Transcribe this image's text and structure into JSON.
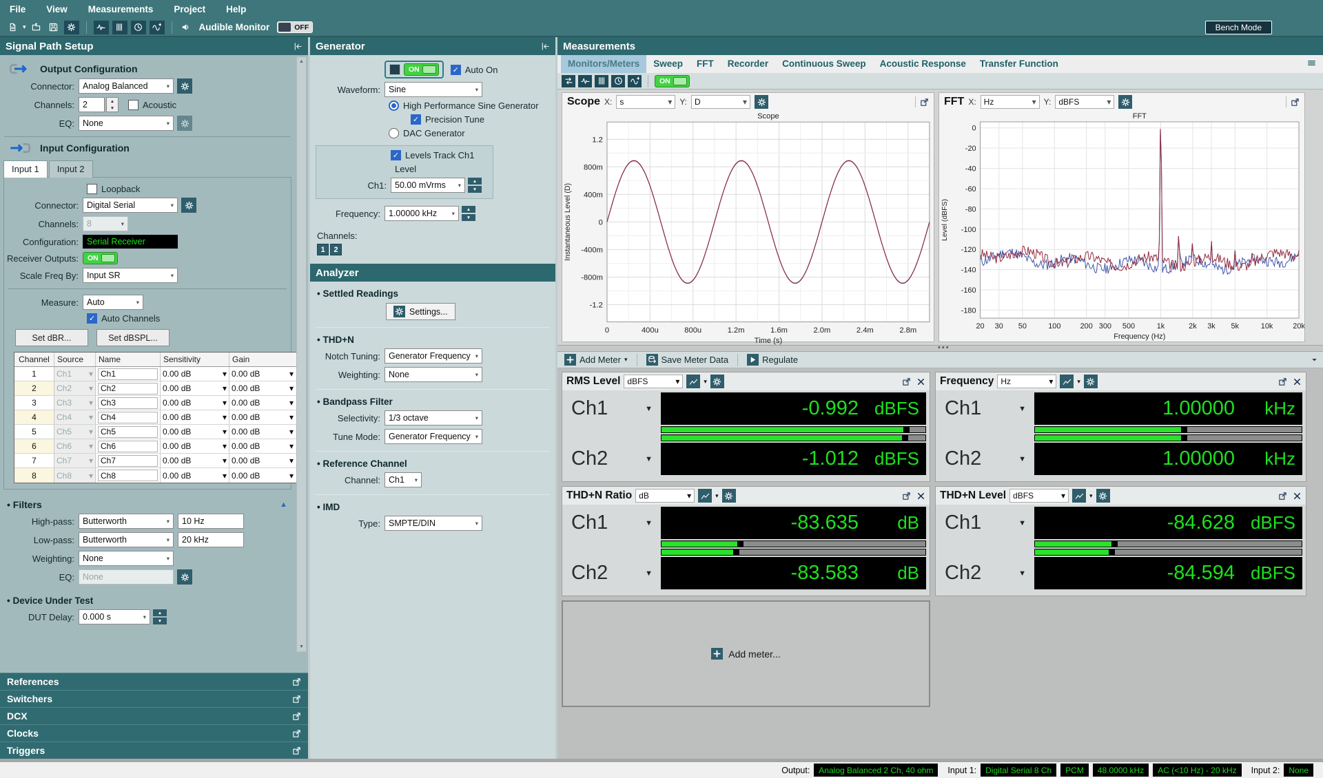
{
  "app": {
    "menu_items": [
      "File",
      "View",
      "Measurements",
      "Project",
      "Help"
    ],
    "audible_monitor_label": "Audible Monitor",
    "audible_monitor_state": "OFF",
    "bench_mode_label": "Bench Mode"
  },
  "signal_path": {
    "title": "Signal Path Setup",
    "output": {
      "section_title": "Output Configuration",
      "connector_label": "Connector:",
      "connector_value": "Analog Balanced",
      "channels_label": "Channels:",
      "channels_value": "2",
      "acoustic_label": "Acoustic",
      "eq_label": "EQ:",
      "eq_value": "None"
    },
    "input": {
      "section_title": "Input Configuration",
      "tabs": [
        "Input 1",
        "Input 2"
      ],
      "active_tab": "Input 1",
      "loopback_label": "Loopback",
      "connector_label": "Connector:",
      "connector_value": "Digital Serial",
      "channels_label": "Channels:",
      "channels_value": "8",
      "configuration_label": "Configuration:",
      "configuration_value": "Serial Receiver",
      "receiver_outputs_label": "Receiver Outputs:",
      "receiver_outputs_state": "ON",
      "scale_freq_label": "Scale Freq By:",
      "scale_freq_value": "Input SR",
      "measure_label": "Measure:",
      "measure_value": "Auto",
      "auto_channels_label": "Auto Channels",
      "set_dbr_button": "Set dBR...",
      "set_d bspl_button_unused": "",
      "set_dbspl_button": "Set dBSPL...",
      "channel_table": {
        "headers": [
          "Channel",
          "Source",
          "Name",
          "Sensitivity",
          "Gain"
        ],
        "rows": [
          {
            "channel": "1",
            "source": "Ch1",
            "name": "Ch1",
            "sensitivity": "0.00 dB",
            "gain": "0.00 dB"
          },
          {
            "channel": "2",
            "source": "Ch2",
            "name": "Ch2",
            "sensitivity": "0.00 dB",
            "gain": "0.00 dB"
          },
          {
            "channel": "3",
            "source": "Ch3",
            "name": "Ch3",
            "sensitivity": "0.00 dB",
            "gain": "0.00 dB"
          },
          {
            "channel": "4",
            "source": "Ch4",
            "name": "Ch4",
            "sensitivity": "0.00 dB",
            "gain": "0.00 dB"
          },
          {
            "channel": "5",
            "source": "Ch5",
            "name": "Ch5",
            "sensitivity": "0.00 dB",
            "gain": "0.00 dB"
          },
          {
            "channel": "6",
            "source": "Ch6",
            "name": "Ch6",
            "sensitivity": "0.00 dB",
            "gain": "0.00 dB"
          },
          {
            "channel": "7",
            "source": "Ch7",
            "name": "Ch7",
            "sensitivity": "0.00 dB",
            "gain": "0.00 dB"
          },
          {
            "channel": "8",
            "source": "Ch8",
            "name": "Ch8",
            "sensitivity": "0.00 dB",
            "gain": "0.00 dB"
          }
        ]
      }
    },
    "filters": {
      "section_title": "Filters",
      "high_pass_label": "High-pass:",
      "high_pass_type": "Butterworth",
      "high_pass_freq": "10 Hz",
      "low_pass_label": "Low-pass:",
      "low_pass_type": "Butterworth",
      "low_pass_freq": "20 kHz",
      "weighting_label": "Weighting:",
      "weighting_value": "None",
      "eq_label": "EQ:",
      "eq_value": "None"
    },
    "dut": {
      "section_title": "Device Under Test",
      "delay_label": "DUT Delay:",
      "delay_value": "0.000 s"
    },
    "sections": [
      "References",
      "Switchers",
      "DCX",
      "Clocks",
      "Triggers"
    ]
  },
  "generator": {
    "title": "Generator",
    "on_state": "ON",
    "auto_on_label": "Auto On",
    "waveform_label": "Waveform:",
    "waveform_value": "Sine",
    "hp_sine_label": "High Performance Sine Generator",
    "precision_tune_label": "Precision Tune",
    "dac_label": "DAC Generator",
    "levels_track_label": "Levels Track Ch1",
    "level_label": "Level",
    "ch1_label": "Ch1:",
    "ch1_level": "50.00 mVrms",
    "frequency_label": "Frequency:",
    "frequency_value": "1.00000 kHz",
    "channels_label": "Channels:",
    "channel_buttons": [
      "1",
      "2"
    ]
  },
  "analyzer": {
    "title": "Analyzer",
    "settled_title": "Settled Readings",
    "settings_button": "Settings...",
    "thdn_title": "THD+N",
    "notch_label": "Notch Tuning:",
    "notch_value": "Generator Frequency",
    "weighting_label": "Weighting:",
    "weighting_value": "None",
    "bandpass_title": "Bandpass Filter",
    "selectivity_label": "Selectivity:",
    "selectivity_value": "1/3 octave",
    "tune_mode_label": "Tune Mode:",
    "tune_mode_value": "Generator Frequency",
    "refch_title": "Reference Channel",
    "channel_label": "Channel:",
    "channel_value": "Ch1",
    "imd_title": "IMD",
    "type_label": "Type:",
    "type_value": "SMPTE/DIN"
  },
  "measurements": {
    "title": "Measurements",
    "tabs": [
      "Monitors/Meters",
      "Sweep",
      "FFT",
      "Recorder",
      "Continuous Sweep",
      "Acoustic Response",
      "Transfer Function"
    ],
    "active_tab": "Monitors/Meters",
    "on_state": "ON",
    "scope_header": {
      "title": "Scope",
      "x_label": "X:",
      "x_value": "s",
      "y_label": "Y:",
      "y_value": "D"
    },
    "fft_header": {
      "title": "FFT",
      "x_label": "X:",
      "x_value": "Hz",
      "y_label": "Y:",
      "y_value": "dBFS"
    },
    "meter_toolbar": {
      "add_meter": "Add Meter",
      "save_meter_data": "Save Meter Data",
      "regulate": "Regulate"
    },
    "add_meter_placeholder": "Add meter...",
    "meters": [
      {
        "title": "RMS Level",
        "unit": "dBFS",
        "rows": [
          {
            "ch": "Ch1",
            "value": "-0.992",
            "unit": "dBFS",
            "bar": 0.92
          },
          {
            "ch": "Ch2",
            "value": "-1.012",
            "unit": "dBFS",
            "bar": 0.915
          }
        ]
      },
      {
        "title": "Frequency",
        "unit": "Hz",
        "rows": [
          {
            "ch": "Ch1",
            "value": "1.00000",
            "unit": "kHz",
            "bar": 0.55
          },
          {
            "ch": "Ch2",
            "value": "1.00000",
            "unit": "kHz",
            "bar": 0.55
          }
        ]
      },
      {
        "title": "THD+N Ratio",
        "unit": "dB",
        "rows": [
          {
            "ch": "Ch1",
            "value": "-83.635",
            "unit": "dB",
            "bar": 0.29
          },
          {
            "ch": "Ch2",
            "value": "-83.583",
            "unit": "dB",
            "bar": 0.275
          }
        ]
      },
      {
        "title": "THD+N Level",
        "unit": "dBFS",
        "rows": [
          {
            "ch": "Ch1",
            "value": "-84.628",
            "unit": "dBFS",
            "bar": 0.29
          },
          {
            "ch": "Ch2",
            "value": "-84.594",
            "unit": "dBFS",
            "bar": 0.28
          }
        ]
      }
    ]
  },
  "status_bar": {
    "output_label": "Output:",
    "output_value": "Analog Balanced 2 Ch, 40 ohm",
    "input1_label": "Input 1:",
    "input1_badges": [
      "Digital Serial 8 Ch",
      "PCM",
      "48.0000 kHz",
      "AC (<10 Hz) - 20 kHz"
    ],
    "input2_label": "Input 2:",
    "input2_value": "None"
  },
  "chart_data": [
    {
      "type": "line",
      "title": "Scope",
      "xlabel": "Time (s)",
      "ylabel": "Instantaneous Level (D)",
      "x_ticks": [
        "0",
        "400u",
        "800u",
        "1.2m",
        "1.6m",
        "2.0m",
        "2.4m",
        "2.8m"
      ],
      "x_tick_values": [
        0,
        0.0004,
        0.0008,
        0.0012,
        0.0016,
        0.002,
        0.0024,
        0.0028
      ],
      "y_ticks": [
        "1.2",
        "800m",
        "400m",
        "0",
        "-400m",
        "-800m",
        "-1.2"
      ],
      "y_tick_values": [
        1.2,
        0.8,
        0.4,
        0,
        -0.4,
        -0.8,
        -1.2
      ],
      "xlim": [
        0,
        0.003
      ],
      "ylim": [
        -1.45,
        1.45
      ],
      "grid": true,
      "legend": false,
      "signal": {
        "shape": "sine",
        "frequency_hz": 1000,
        "amplitude": 0.891,
        "channels": [
          "Ch2",
          "Ch1"
        ]
      },
      "colors": [
        "#4055A8",
        "#93293B"
      ]
    },
    {
      "type": "line",
      "title": "FFT",
      "xlabel": "Frequency (Hz)",
      "ylabel": "Level (dBFS)",
      "x_ticks": [
        "20",
        "30",
        "50",
        "100",
        "200",
        "300",
        "500",
        "1k",
        "2k",
        "3k",
        "5k",
        "10k",
        "20k"
      ],
      "x_tick_values": [
        20,
        30,
        50,
        100,
        200,
        300,
        500,
        1000,
        2000,
        3000,
        5000,
        10000,
        20000
      ],
      "y_ticks": [
        0,
        -20,
        -40,
        -60,
        -80,
        -100,
        -120,
        -140,
        -160,
        -180
      ],
      "xlim": [
        20,
        20000
      ],
      "ylim": [
        -188,
        6
      ],
      "x_scale": "log",
      "grid": true,
      "legend": false,
      "noise_floor_dbfs": -132,
      "peaks": [
        {
          "hz": 1000,
          "dbfs": -1
        },
        {
          "hz": 1480,
          "dbfs": -107
        },
        {
          "hz": 2000,
          "dbfs": -113
        },
        {
          "hz": 3000,
          "dbfs": -112
        },
        {
          "hz": 5000,
          "dbfs": -121
        },
        {
          "hz": 7200,
          "dbfs": -124
        }
      ],
      "colors": [
        "#4055A8",
        "#93293B"
      ]
    }
  ]
}
